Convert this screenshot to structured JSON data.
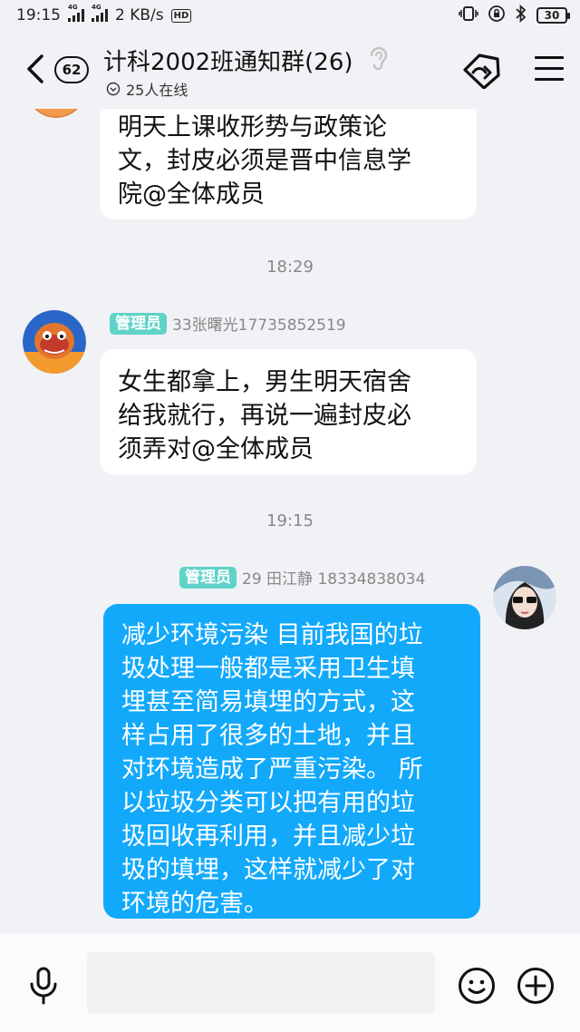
{
  "status_bar": {
    "time": "19:15",
    "network_label_1": "4G",
    "network_label_2": "4G",
    "speed": "2 KB/s",
    "hd_label": "HD",
    "battery": "30"
  },
  "header": {
    "unread_count": "62",
    "title": "计科2002班通知群(26)",
    "online": "25人在线"
  },
  "messages": [
    {
      "text_lines": [
        "明天上课收形势与政策论",
        "文，封皮必须是晋中信息学",
        "院@全体成员"
      ]
    },
    {
      "time": "18:29",
      "badge": "管理员",
      "sender": "33张曙光17735852519",
      "text_lines": [
        "女生都拿上，男生明天宿舍",
        "给我就行，再说一遍封皮必",
        "须弄对@全体成员"
      ]
    },
    {
      "time": "19:15",
      "badge": "管理员",
      "sender": "29  田江静  18334838034",
      "text_lines": [
        "减少环境污染 目前我国的垃",
        "圾处理一般都是采用卫生填",
        "埋甚至简易填埋的方式，这",
        "样占用了很多的土地，并且",
        "对环境造成了严重污染。 所",
        "以垃圾分类可以把有用的垃",
        "圾回收再利用，并且减少垃",
        "圾的填埋，这样就减少了对",
        "环境的危害。"
      ]
    }
  ],
  "input": {
    "placeholder": ""
  },
  "colors": {
    "my_bubble": "#12a9fb",
    "admin_badge": "#5fd3c8",
    "background": "#f1f2f5"
  }
}
